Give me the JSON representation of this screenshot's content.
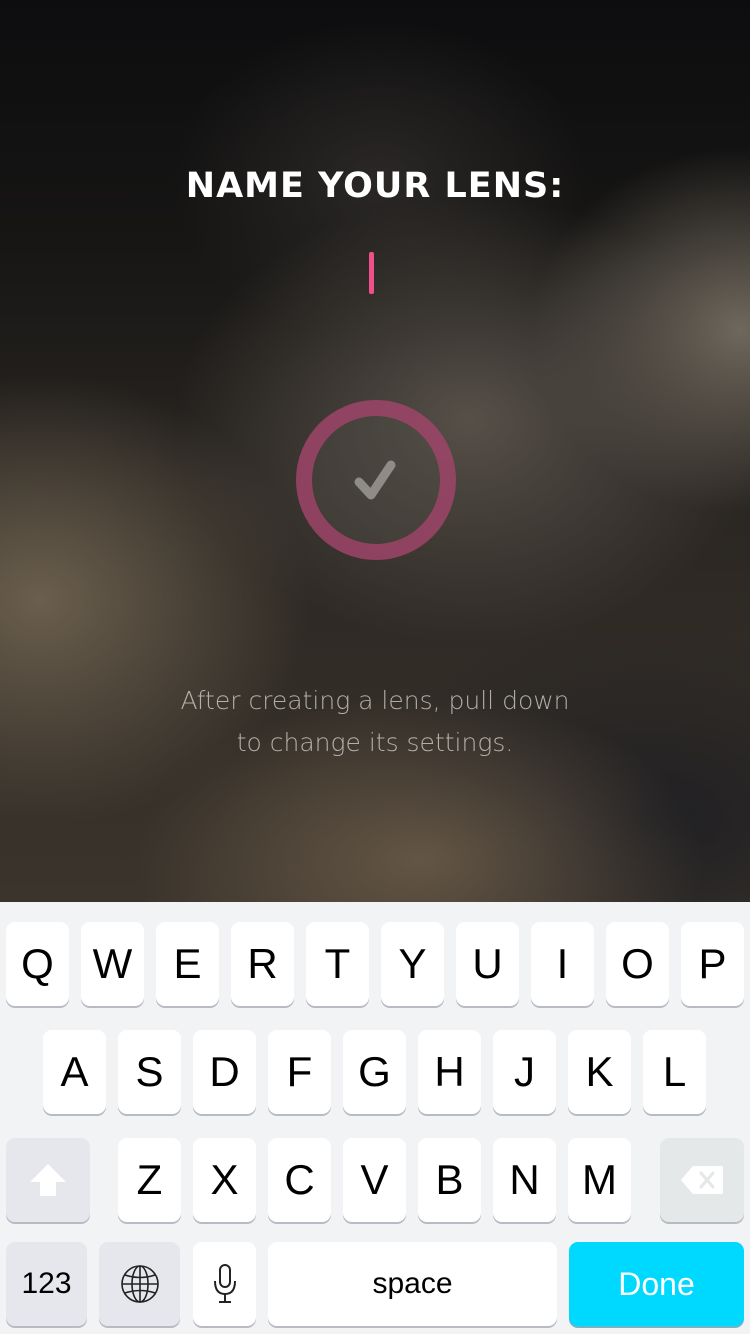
{
  "screen": {
    "title": "NAME YOUR LENS:",
    "name_value": "",
    "hint": "After creating a lens, pull down to change its settings.",
    "confirm_icon": "checkmark-icon",
    "accent_color": "#f0508a"
  },
  "keyboard": {
    "row1": [
      "Q",
      "W",
      "E",
      "R",
      "T",
      "Y",
      "U",
      "I",
      "O",
      "P"
    ],
    "row2": [
      "A",
      "S",
      "D",
      "F",
      "G",
      "H",
      "J",
      "K",
      "L"
    ],
    "row3": [
      "Z",
      "X",
      "C",
      "V",
      "B",
      "N",
      "M"
    ],
    "numbers_label": "123",
    "space_label": "space",
    "done_label": "Done",
    "shift_icon": "shift-arrow-icon",
    "delete_icon": "backspace-icon",
    "globe_icon": "globe-icon",
    "mic_icon": "microphone-icon",
    "done_color": "#00d9ff"
  }
}
